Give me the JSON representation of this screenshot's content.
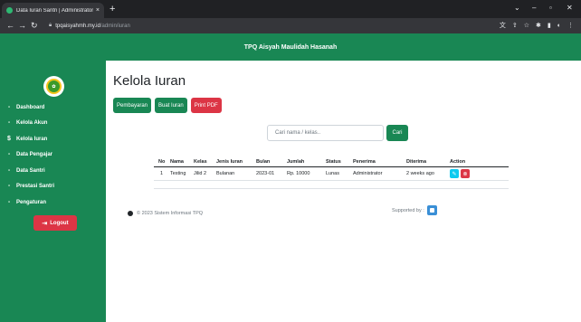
{
  "browser": {
    "tab_title": "Data Iuran Santri | Administrator",
    "tab_close": "×",
    "new_tab": "+",
    "url_host": "tpqaisyahmh.my.id",
    "url_path": "/admin/iuran"
  },
  "header": {
    "brand": "TPQ Aisyah Maulidah Hasanah"
  },
  "sidebar": {
    "items": [
      {
        "label": "Dashboard",
        "icon": "dot-icon"
      },
      {
        "label": "Kelola Akun",
        "icon": "dot-icon"
      },
      {
        "label": "Kelola Iuran",
        "icon": "dollar-icon",
        "glyph": "$"
      },
      {
        "label": "Data Pengajar",
        "icon": "dot-icon"
      },
      {
        "label": "Data Santri",
        "icon": "dot-icon"
      },
      {
        "label": "Prestasi Santri",
        "icon": "dot-icon"
      },
      {
        "label": "Pengaturan",
        "icon": "dot-icon"
      }
    ],
    "logout_label": "Logout"
  },
  "main": {
    "title": "Kelola Iuran",
    "buttons": {
      "pembayaran": "Pembayaran",
      "buat_iuran": "Buat Iuran",
      "print_pdf": "Print PDF"
    },
    "search": {
      "placeholder": "Cari nama / kelas..",
      "button": "Cari"
    },
    "table": {
      "headers": [
        "No",
        "Nama",
        "Kelas",
        "Jenis Iuran",
        "Bulan",
        "Jumlah",
        "Status",
        "Penerima",
        "Diterima",
        "Action"
      ],
      "rows": [
        [
          "1",
          "Testing",
          "Jilid 2",
          "Bulanan",
          "2023-01",
          "Rp. 10000",
          "Lunas",
          "Administrator",
          "2 weeks ago"
        ]
      ]
    }
  },
  "footer": {
    "copyright": "© 2023 Sistem Informasi TPQ",
    "supported_by": "Supported by :"
  },
  "colors": {
    "primary_green": "#198754",
    "danger_red": "#dc3545",
    "info_cyan": "#0dcaf0"
  }
}
